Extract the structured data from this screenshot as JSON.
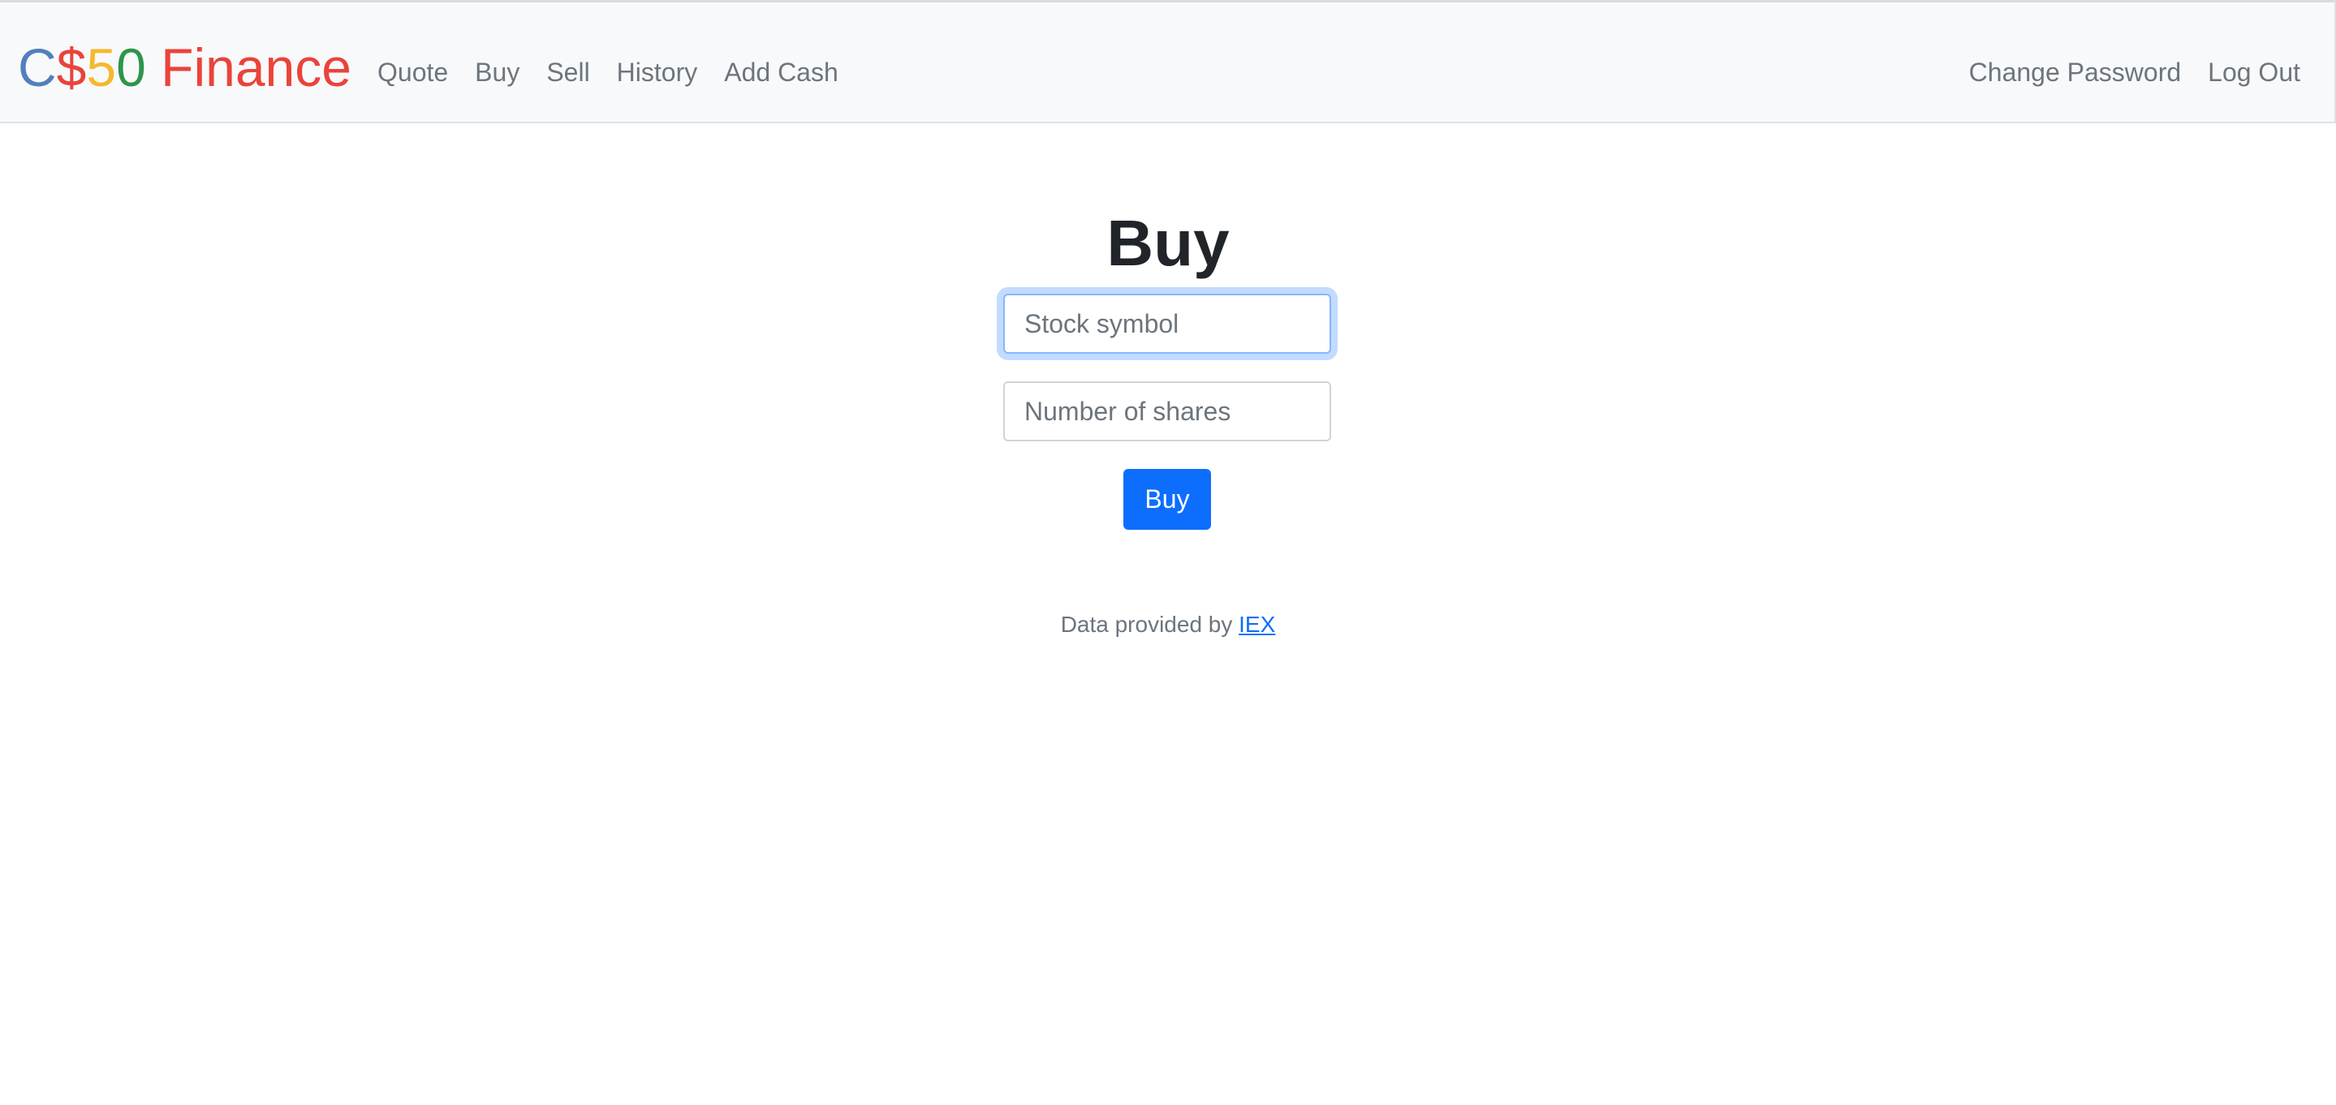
{
  "brand": {
    "parts": [
      {
        "text": "C",
        "color": "#537fbe"
      },
      {
        "text": "$",
        "color": "#ea433b"
      },
      {
        "text": "5",
        "color": "#f5b82e"
      },
      {
        "text": "0",
        "color": "#2e944b"
      },
      {
        "text": " Finance",
        "color": "#ea433b"
      }
    ]
  },
  "nav": {
    "left": [
      "Quote",
      "Buy",
      "Sell",
      "History",
      "Add Cash"
    ],
    "right": [
      "Change Password",
      "Log Out"
    ]
  },
  "main": {
    "title": "Buy",
    "symbol_placeholder": "Stock symbol",
    "shares_placeholder": "Number of shares",
    "submit_label": "Buy"
  },
  "footer": {
    "prefix": "Data provided by ",
    "link_text": "IEX"
  },
  "colors": {
    "navbar_bg": "#f8f9fa",
    "primary": "#0d6efd",
    "muted_text": "#6c757d"
  }
}
